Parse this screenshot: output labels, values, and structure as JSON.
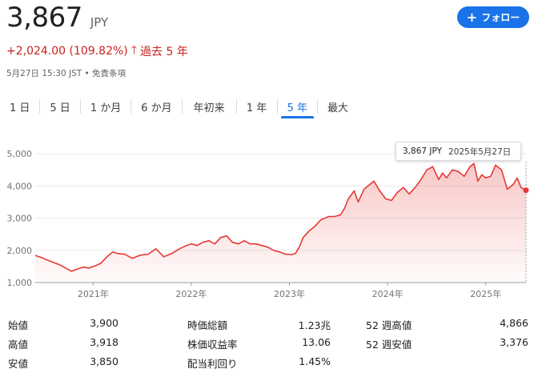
{
  "quote": {
    "price": "3,867",
    "currency": "JPY",
    "change": "+2,024.00 (109.82%)",
    "change_period": "過去 5 年",
    "meta": "5月27日 15:30 JST • 免責条項"
  },
  "follow_button": {
    "label": "フォロー"
  },
  "tabs": [
    "1 日",
    "5 日",
    "1 か月",
    "6 か月",
    "年初来",
    "1 年",
    "5 年",
    "最大"
  ],
  "active_tab": "5 年",
  "tooltip": {
    "price": "3,867 JPY",
    "date": "2025年5月27日"
  },
  "colors": {
    "line": "#e53935",
    "accent": "#1a73e8",
    "negative": "#c5221f"
  },
  "chart_data": {
    "type": "area",
    "title": "",
    "xlabel": "",
    "ylabel": "",
    "ylim": [
      1000,
      5500
    ],
    "y_ticks": [
      "1,000",
      "2,000",
      "3,000",
      "4,000",
      "5,000"
    ],
    "y_tick_values": [
      1000,
      2000,
      3000,
      4000,
      5000
    ],
    "x_ticks": [
      "2021年",
      "2022年",
      "2023年",
      "2024年",
      "2025年"
    ],
    "x_tick_values": [
      2021.0,
      2022.0,
      2023.0,
      2024.0,
      2025.0
    ],
    "x_range": [
      2020.41,
      2025.41
    ],
    "grid": true,
    "x": [
      2020.41,
      2020.47,
      2020.53,
      2020.6,
      2020.66,
      2020.72,
      2020.78,
      2020.84,
      2020.9,
      2020.96,
      2021.02,
      2021.08,
      2021.14,
      2021.2,
      2021.25,
      2021.32,
      2021.4,
      2021.48,
      2021.56,
      2021.64,
      2021.72,
      2021.8,
      2021.88,
      2021.95,
      2022.0,
      2022.06,
      2022.12,
      2022.18,
      2022.24,
      2022.3,
      2022.36,
      2022.42,
      2022.48,
      2022.54,
      2022.6,
      2022.66,
      2022.72,
      2022.78,
      2022.84,
      2022.9,
      2022.96,
      2023.02,
      2023.06,
      2023.1,
      2023.14,
      2023.2,
      2023.26,
      2023.32,
      2023.4,
      2023.46,
      2023.52,
      2023.56,
      2023.6,
      2023.66,
      2023.7,
      2023.76,
      2023.82,
      2023.86,
      2023.92,
      2023.98,
      2024.04,
      2024.1,
      2024.16,
      2024.22,
      2024.28,
      2024.34,
      2024.4,
      2024.46,
      2024.52,
      2024.56,
      2024.6,
      2024.66,
      2024.72,
      2024.78,
      2024.84,
      2024.88,
      2024.92,
      2024.96,
      2025.0,
      2025.05,
      2025.1,
      2025.16,
      2025.22,
      2025.28,
      2025.32,
      2025.36,
      2025.41
    ],
    "series": [
      {
        "values": [
          1843,
          1780,
          1700,
          1620,
          1550,
          1450,
          1350,
          1420,
          1480,
          1450,
          1520,
          1600,
          1800,
          1950,
          1900,
          1880,
          1750,
          1850,
          1880,
          2050,
          1800,
          1900,
          2050,
          2150,
          2200,
          2150,
          2250,
          2300,
          2200,
          2400,
          2450,
          2250,
          2200,
          2300,
          2200,
          2200,
          2150,
          2100,
          2000,
          1950,
          1880,
          1870,
          1900,
          2100,
          2400,
          2600,
          2750,
          2950,
          3050,
          3050,
          3100,
          3300,
          3600,
          3850,
          3500,
          3900,
          4050,
          4150,
          3850,
          3600,
          3550,
          3800,
          3950,
          3750,
          3950,
          4200,
          4500,
          4600,
          4200,
          4400,
          4250,
          4500,
          4450,
          4300,
          4600,
          4700,
          4150,
          4350,
          4250,
          4300,
          4650,
          4500,
          3900,
          4050,
          4250,
          3950,
          3867
        ]
      }
    ]
  },
  "stats": [
    {
      "label": "始値",
      "value": "3,900"
    },
    {
      "label": "高値",
      "value": "3,918"
    },
    {
      "label": "安値",
      "value": "3,850"
    },
    {
      "label": "時価総額",
      "value": "1.23兆"
    },
    {
      "label": "株価収益率",
      "value": "13.06"
    },
    {
      "label": "配当利回り",
      "value": "1.45%"
    },
    {
      "label": "52 週高値",
      "value": "4,866"
    },
    {
      "label": "52 週安値",
      "value": "3,376"
    }
  ]
}
